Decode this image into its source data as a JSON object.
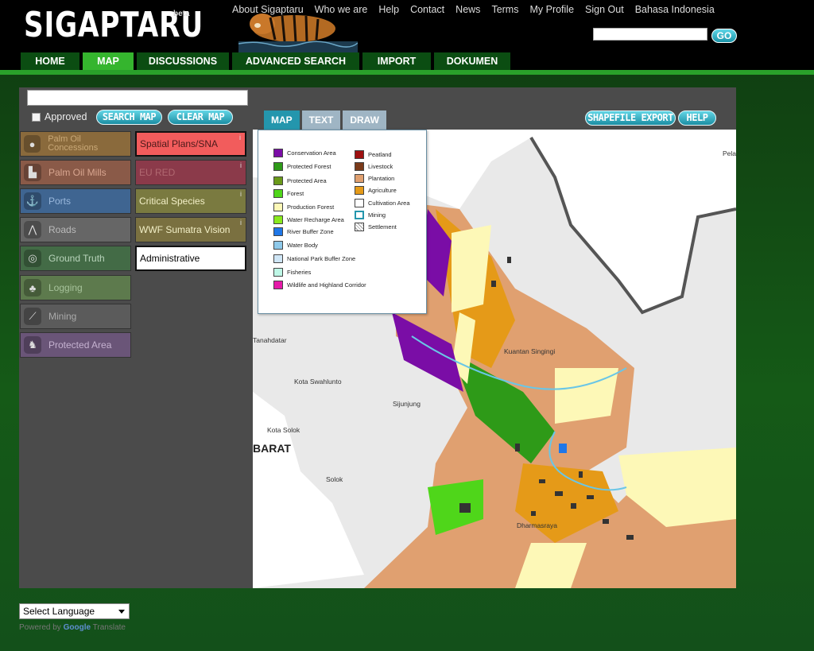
{
  "header": {
    "logo": "SIGAPTARU",
    "beta": "beta",
    "top_links": [
      "About Sigaptaru",
      "Who we are",
      "Help",
      "Contact",
      "News",
      "Terms",
      "My Profile",
      "Sign Out",
      "Bahasa Indonesia"
    ],
    "search_value": "",
    "go_label": "GO"
  },
  "nav": {
    "tabs": [
      {
        "label": "HOME",
        "active": false
      },
      {
        "label": "MAP",
        "active": true
      },
      {
        "label": "DISCUSSIONS",
        "active": false
      },
      {
        "label": "ADVANCED SEARCH",
        "active": false
      },
      {
        "label": "IMPORT",
        "active": false
      },
      {
        "label": "DOKUMEN",
        "active": false
      }
    ]
  },
  "panel": {
    "search_value": "",
    "approved_label": "Approved",
    "search_map_label": "SEARCH MAP",
    "clear_map_label": "CLEAR MAP",
    "layers": [
      {
        "label": "Palm Oil Concessions",
        "icon": "oil-drop-icon",
        "color": "#8a6a3c"
      },
      {
        "label": "Palm Oil Mills",
        "icon": "factory-icon",
        "color": "#8a5a48"
      },
      {
        "label": "Ports",
        "icon": "anchor-icon",
        "color": "#3f6591"
      },
      {
        "label": "Roads",
        "icon": "road-icon",
        "color": "#6b6b6b"
      },
      {
        "label": "Ground Truth",
        "icon": "target-icon",
        "color": "#436b46"
      },
      {
        "label": "Logging",
        "icon": "trees-icon",
        "color": "#5d7a4d"
      },
      {
        "label": "Mining",
        "icon": "pickaxe-icon",
        "color": "#5b5b5b"
      },
      {
        "label": "Protected Area",
        "icon": "animal-icon",
        "color": "#6a5578"
      }
    ],
    "plans": [
      {
        "label": "Spatial Plans/SNA",
        "color": "#f25c5c",
        "text": "#4b1a1a"
      },
      {
        "label": "EU RED",
        "color": "#8b3a4a",
        "text": "#b06870"
      },
      {
        "label": "Critical Species",
        "color": "#7a7a40",
        "text": "#f2efc6"
      },
      {
        "label": "WWF Sumatra Vision",
        "color": "#7a7040",
        "text": "#f2efc6"
      },
      {
        "label": "Administrative",
        "color": "#ffffff",
        "text": "#000000"
      }
    ]
  },
  "map": {
    "tabs": [
      "MAP",
      "TEXT",
      "DRAW"
    ],
    "shapefile_label": "SHAPEFILE EXPORT",
    "help_label": "HELP",
    "legend_left": [
      {
        "label": "Conservation Area",
        "color": "#7a0da6"
      },
      {
        "label": "Protected Forest",
        "color": "#2e9a18"
      },
      {
        "label": "Protected Area",
        "color": "#6a9a1a"
      },
      {
        "label": "Forest",
        "color": "#4fd61a"
      },
      {
        "label": "Production Forest",
        "color": "#fdf8b7"
      },
      {
        "label": "Water Recharge Area",
        "color": "#8aea1e"
      },
      {
        "label": "River Buffer Zone",
        "color": "#1f77e8"
      },
      {
        "label": "Water Body",
        "color": "#8ec9ea"
      },
      {
        "label": "National Park Buffer Zone",
        "color": "#cfe6f6"
      },
      {
        "label": "Fisheries",
        "color": "#bef7e6"
      },
      {
        "label": "Wildlife and Highland Corridor",
        "color": "#e51aa8"
      }
    ],
    "legend_right": [
      {
        "label": "Peatland",
        "color": "#9e1010"
      },
      {
        "label": "Livestock",
        "color": "#7a3a1a"
      },
      {
        "label": "Plantation",
        "color": "#e0a070"
      },
      {
        "label": "Agriculture",
        "color": "#e59a18"
      },
      {
        "label": "Cultivation Area",
        "color": "#ffffff"
      },
      {
        "label": "Mining",
        "color": "#ffffff"
      },
      {
        "label": "Settlement",
        "color": "#e6e6e6"
      }
    ],
    "places": [
      "Tanahdatar",
      "Kota Swahlunto",
      "Sijunjung",
      "Kota Solok",
      "BARAT",
      "Solok",
      "Kuantan Singingi",
      "Dharmasraya",
      "Pela"
    ]
  },
  "footer": {
    "language_label": "Select Language",
    "powered_label": "Powered by",
    "google_label": "Google",
    "translate_label": "Translate"
  }
}
